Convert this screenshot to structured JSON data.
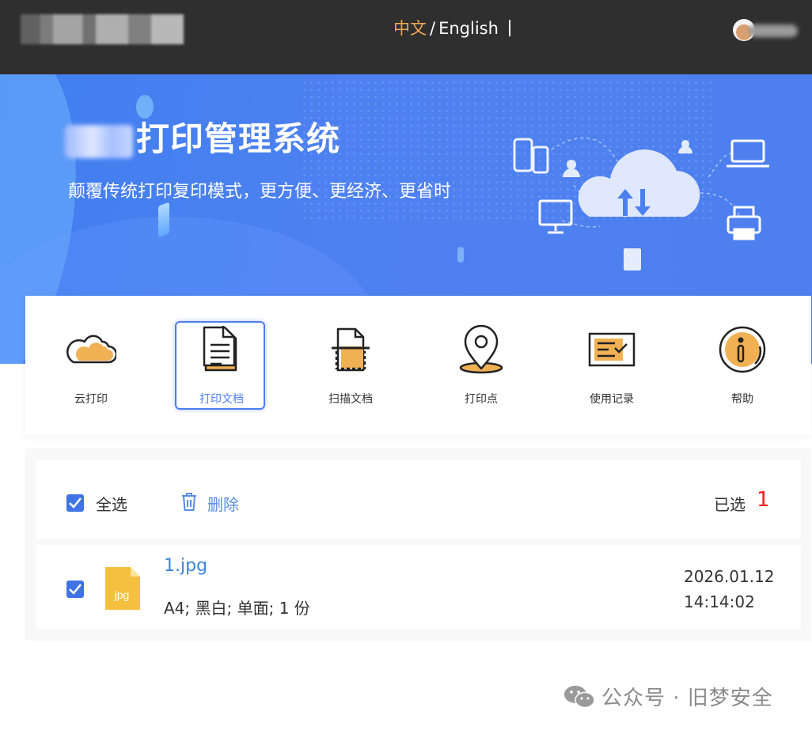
{
  "header": {
    "lang_zh": "中文",
    "lang_separator": "/",
    "lang_en": "English"
  },
  "banner": {
    "title": "打印管理系统",
    "subtitle": "颠覆传统打印复印模式，更方便、更经济、更省时"
  },
  "features": [
    {
      "label": "云打印",
      "icon": "cloud-icon"
    },
    {
      "label": "打印文档",
      "icon": "document-icon",
      "active": true
    },
    {
      "label": "扫描文档",
      "icon": "scan-document-icon"
    },
    {
      "label": "打印点",
      "icon": "location-pin-icon"
    },
    {
      "label": "使用记录",
      "icon": "record-icon"
    },
    {
      "label": "帮助",
      "icon": "info-icon"
    }
  ],
  "list_header": {
    "select_all_label": "全选",
    "select_all_checked": true,
    "delete_label": "删除",
    "selected_label": "已选",
    "selected_count": "1"
  },
  "files": [
    {
      "name": "1.jpg",
      "type_badge": "jpg",
      "meta": "A4; 黑白; 单面; 1 份",
      "date": "2026.01.12",
      "time": "14:14:02",
      "checked": true
    }
  ],
  "watermark": {
    "text": "公众号 · 旧梦安全"
  },
  "colors": {
    "topbar": "#2f2f2f",
    "accent_orange": "#f2a950",
    "banner_blue": "#4d80f0",
    "link_blue": "#3c86d8",
    "checkbox_blue": "#3f73e6",
    "count_red": "#ff1b1b"
  }
}
